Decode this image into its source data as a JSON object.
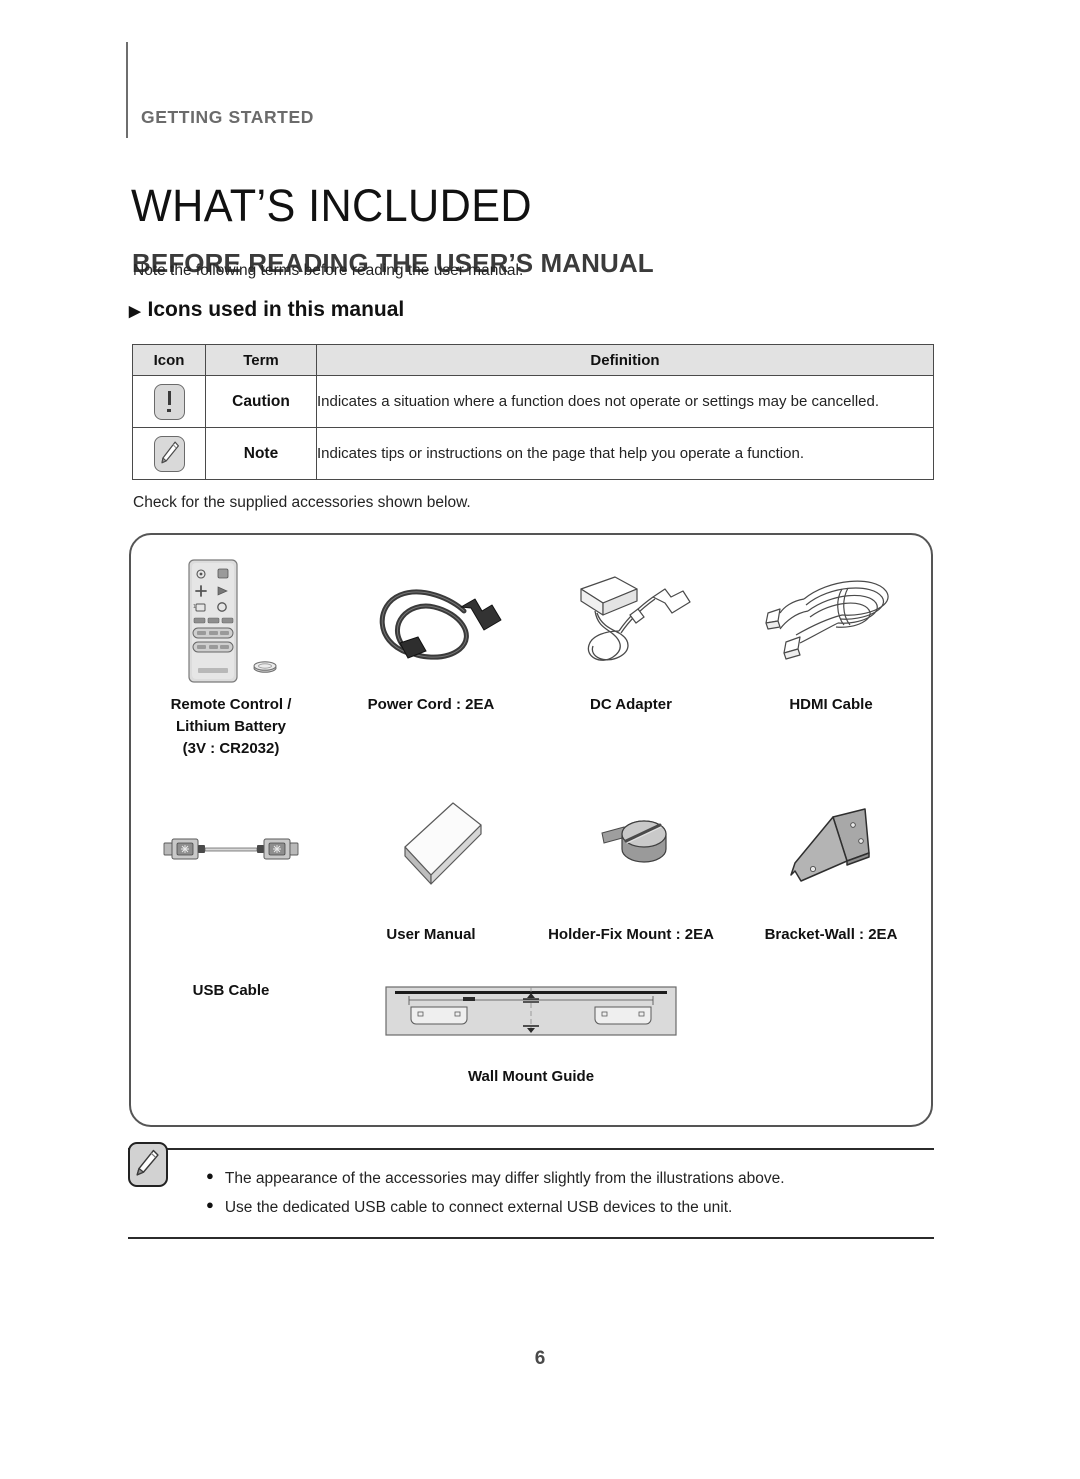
{
  "header": {
    "kicker": "GETTING STARTED",
    "title": "WHAT’S INCLUDED",
    "section_title": "BEFORE READING THE USER’S MANUAL",
    "intro": "Note the following terms before reading the user manual.",
    "subsection_arrow": "▶",
    "subsection": "Icons used in this manual"
  },
  "icon_table": {
    "headers": [
      "Icon",
      "Term",
      "Definition"
    ],
    "rows": [
      {
        "icon": "caution-exclamation-icon",
        "term": "Caution",
        "definition": "Indicates a situation where a function does not operate or settings may be cancelled."
      },
      {
        "icon": "note-pencil-icon",
        "term": "Note",
        "definition": "Indicates tips or instructions on the page that help you operate a function."
      }
    ]
  },
  "check_line": "Check for the supplied accessories shown below.",
  "accessories": {
    "row1": [
      {
        "art": "remote-control-and-battery-illustration",
        "label": "Remote Control /\nLithium Battery\n(3V : CR2032)"
      },
      {
        "art": "power-cord-illustration",
        "label": "Power Cord : 2EA"
      },
      {
        "art": "dc-adapter-illustration",
        "label": "DC Adapter"
      },
      {
        "art": "hdmi-cable-illustration",
        "label": "HDMI Cable"
      }
    ],
    "row2": [
      {
        "art": "usb-cable-illustration",
        "label": "USB Cable"
      },
      {
        "art": "user-manual-illustration",
        "label": "User Manual"
      },
      {
        "art": "holder-fix-mount-illustration",
        "label": "Holder-Fix Mount : 2EA"
      },
      {
        "art": "bracket-wall-illustration",
        "label": "Bracket-Wall : 2EA"
      }
    ],
    "row3": [
      {
        "art": "wall-mount-guide-illustration",
        "label": "Wall Mount Guide"
      }
    ]
  },
  "notes": {
    "icon": "note-pencil-icon",
    "bullet": "●",
    "items": [
      "The appearance of the accessories may differ slightly from the illustrations above.",
      "Use the dedicated USB cable to connect external USB devices to the unit."
    ]
  },
  "page_number": "6",
  "colors": {
    "kicker_gray": "#6b6b6b",
    "rule_gray": "#6e6e6e",
    "table_header_bg": "#e2e2e2",
    "table_border": "#4a4a4a",
    "box_border": "#555555",
    "note_rule": "#2b2b2b"
  }
}
